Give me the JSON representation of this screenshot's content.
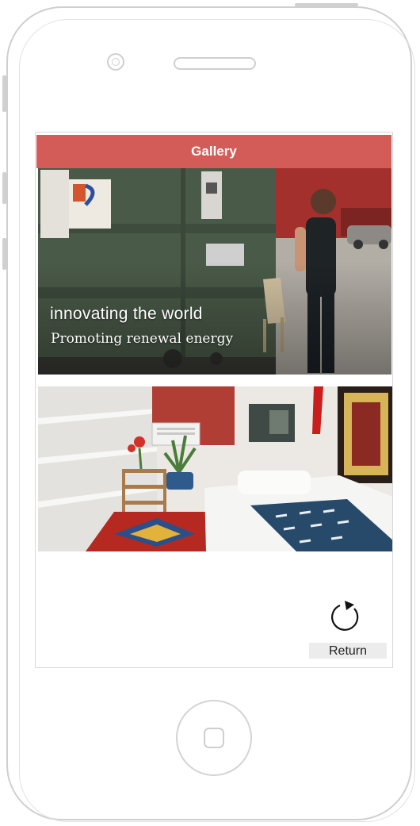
{
  "header": {
    "title": "Gallery"
  },
  "gallery": {
    "slides": [
      {
        "title": "innovating the world",
        "subtitle": "Promoting renewal energy"
      }
    ]
  },
  "return_button": {
    "label": "Return",
    "icon": "refresh-arrow-icon"
  },
  "colors": {
    "header": "#d45c58",
    "header_text": "#ffffff",
    "return_bg": "#ececec"
  }
}
